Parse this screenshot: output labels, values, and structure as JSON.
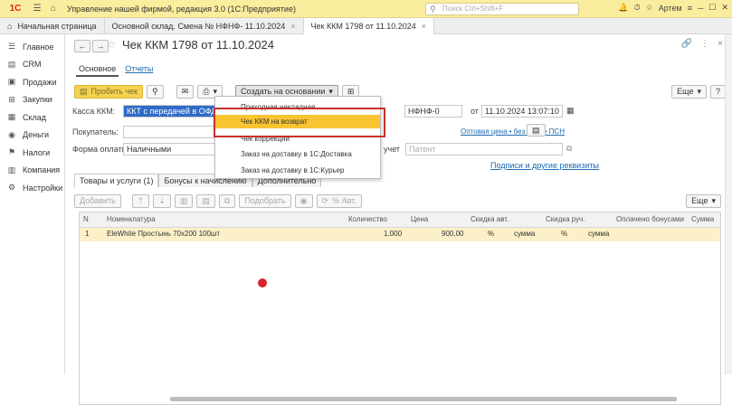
{
  "titlebar": {
    "logo": "1С",
    "title": "Управление нашей фирмой, редакция 3.0  (1С:Предприятие)",
    "search_placeholder": "Поиск Ctrl+Shift+F",
    "user": "Артем"
  },
  "tabs": [
    {
      "label": "Начальная страница"
    },
    {
      "label": "Основной склад. Смена № НФНФ-         11.10.2024"
    },
    {
      "label": "Чек ККМ 1798 от 11.10.2024"
    }
  ],
  "sidebar": {
    "items": [
      {
        "label": "Главное",
        "icon": "menu-icon"
      },
      {
        "label": "CRM",
        "icon": "crm-icon"
      },
      {
        "label": "Продажи",
        "icon": "sales-icon"
      },
      {
        "label": "Закупки",
        "icon": "purchases-icon"
      },
      {
        "label": "Склад",
        "icon": "warehouse-icon"
      },
      {
        "label": "Деньги",
        "icon": "money-icon"
      },
      {
        "label": "Налоги",
        "icon": "taxes-icon"
      },
      {
        "label": "Компания",
        "icon": "company-icon"
      },
      {
        "label": "Настройки",
        "icon": "settings-icon"
      }
    ]
  },
  "document": {
    "title": "Чек ККМ 1798 от 11.10.2024",
    "subtabs": [
      "Основное",
      "Отчеты"
    ]
  },
  "toolbar": {
    "print_check": "Пробить чек",
    "create_based": "Создать на основании",
    "more": "Еще",
    "help": "?"
  },
  "form": {
    "kassa_label": "Касса ККМ:",
    "kassa_value": "ККТ с передачей в ОФД",
    "number_value": "НФНФ-0",
    "date_label": "от",
    "date_value": "11.10.2024 13:07:10",
    "buyer_label": "Покупатель:",
    "price_link": "Оптовая цена • без НДС • ПСН",
    "payment_label": "Форма оплаты:",
    "payment_value": "Наличными",
    "account_label": "учет",
    "patent_value": "Патент",
    "signatures_link": "Подписи и другие реквизиты"
  },
  "dropdown": {
    "items": [
      "Приходная накладная",
      "Чек ККМ на возврат",
      "Чек коррекции",
      "Заказ на доставку в 1С:Доставка",
      "Заказ на доставку в 1С:Курьер"
    ]
  },
  "table_tabs": [
    "Товары и услуги (1)",
    "Бонусы к начислению",
    "Дополнительно"
  ],
  "table_toolbar": {
    "add": "Добавить",
    "pick": "Подобрать",
    "discount": "% Авт.",
    "more": "Еще"
  },
  "table": {
    "columns": [
      "N",
      "Номенклатура",
      "Количество",
      "Цена",
      "Скидка авт.",
      "Скидка руч.",
      "Оплачено бонусами",
      "Сумма"
    ],
    "rows": [
      {
        "n": "1",
        "name": "EleWhite Простынь 70x200 100шт",
        "qty": "1,000",
        "price": "900,00",
        "auto_pct": "%",
        "auto_sum": "сумма",
        "man_pct": "%",
        "man_sum": "сумма"
      }
    ]
  }
}
